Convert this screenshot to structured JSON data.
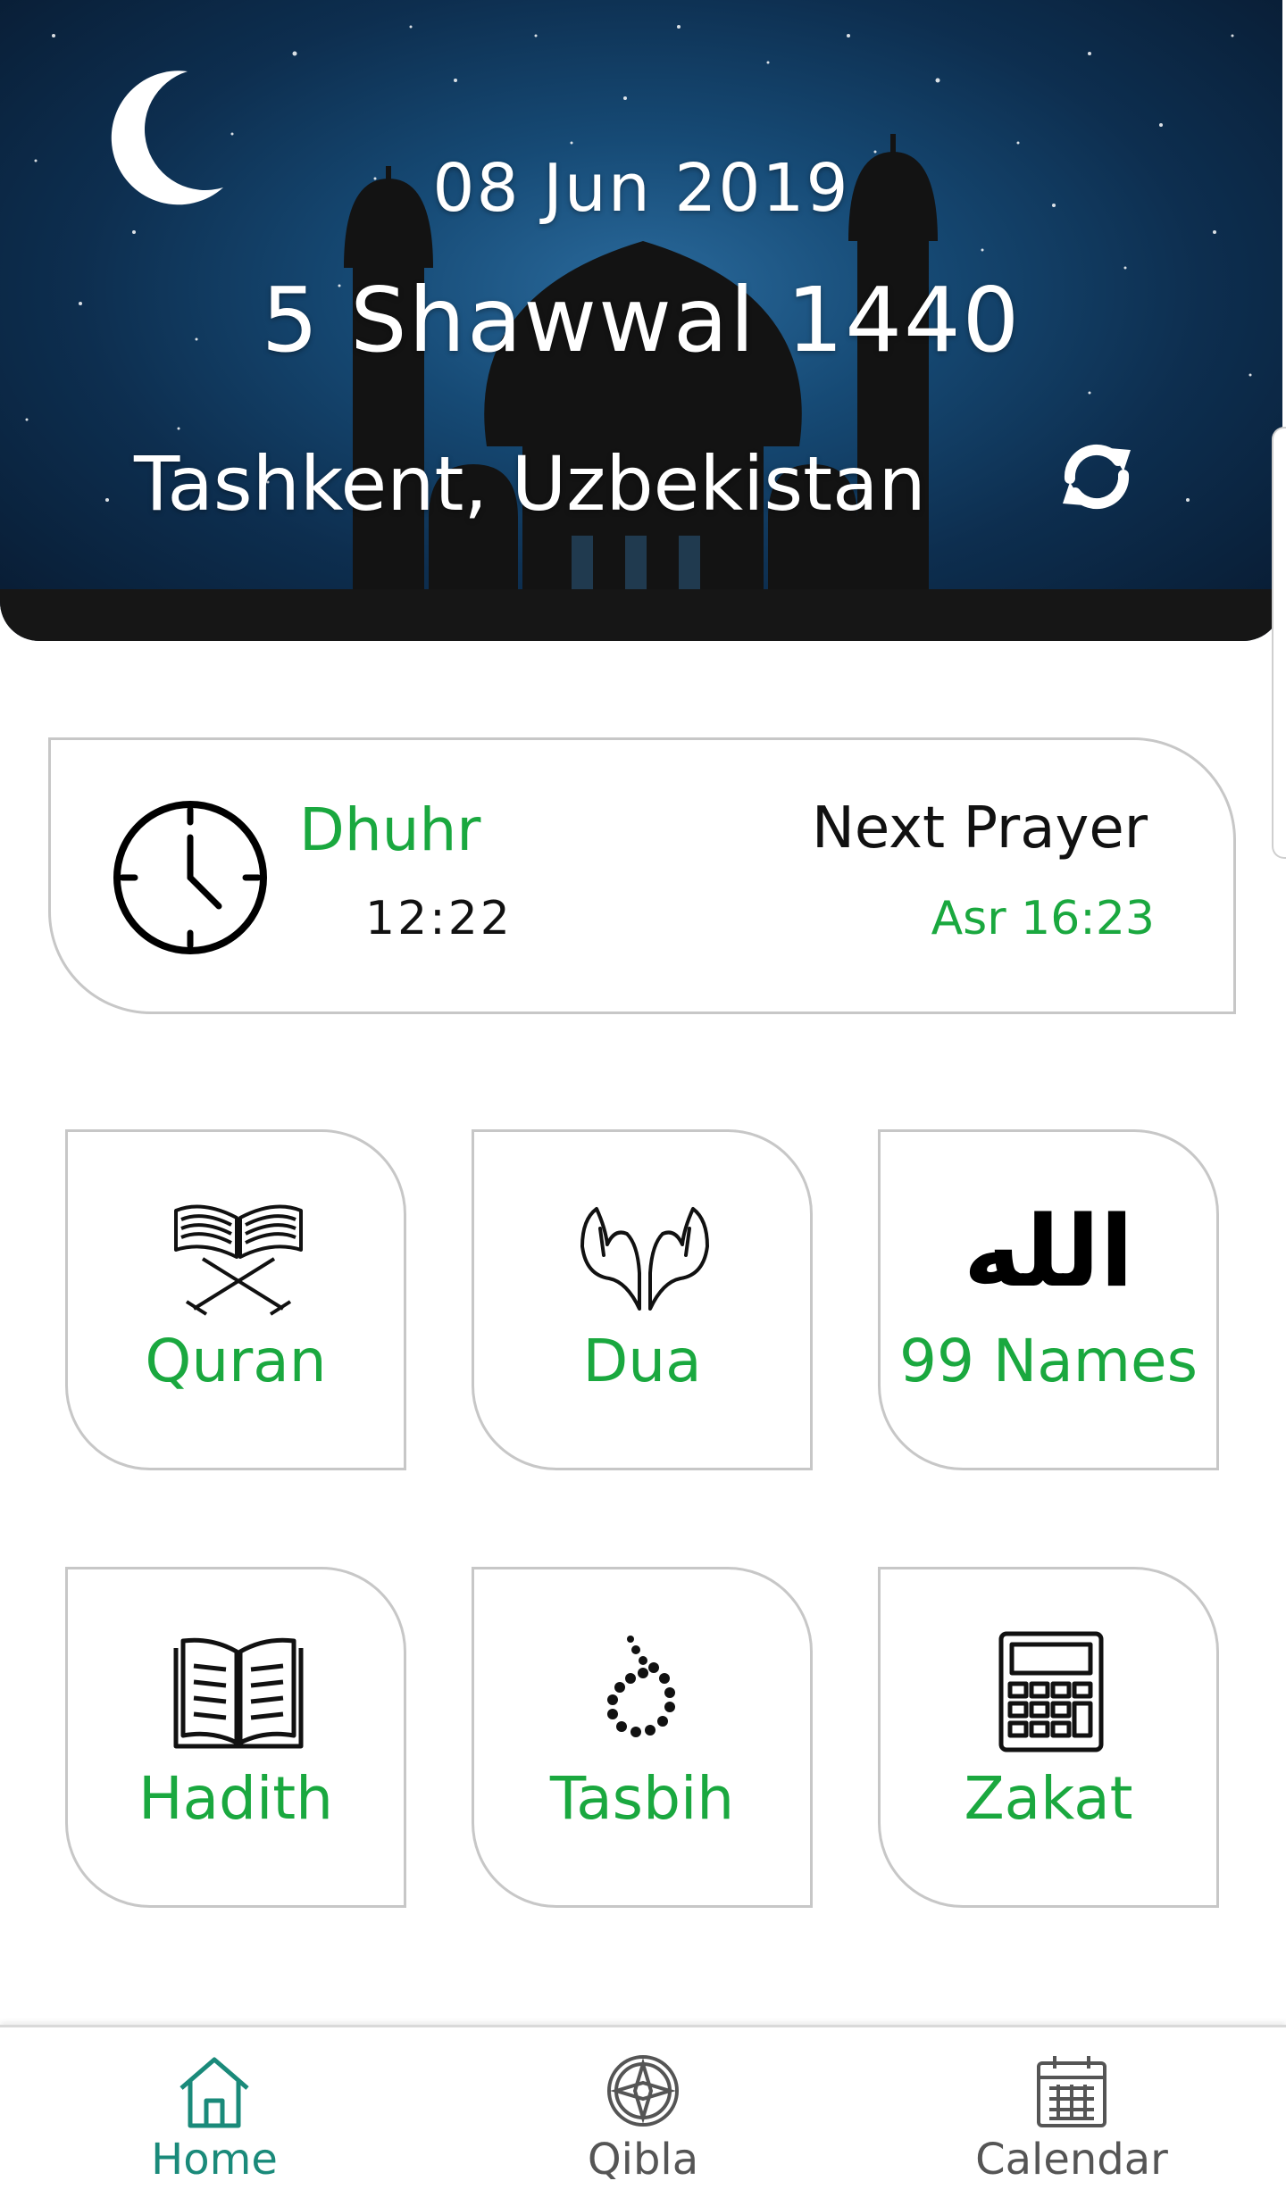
{
  "header": {
    "gregorian_date": "08 Jun 2019",
    "hijri_date": "5 Shawwal 1440",
    "location": "Tashkent, Uzbekistan",
    "refresh_icon": "refresh-icon",
    "moon_icon": "crescent-moon-icon"
  },
  "prayer": {
    "current_name": "Dhuhr",
    "current_time": "12:22",
    "next_label": "Next Prayer",
    "next_value": "Asr 16:23"
  },
  "tiles": [
    {
      "label": "Quran",
      "icon": "quran-icon"
    },
    {
      "label": "Dua",
      "icon": "praying-hands-icon"
    },
    {
      "label": "99 Names",
      "icon": "allah-calligraphy-icon",
      "glyph": "الله"
    },
    {
      "label": "Hadith",
      "icon": "open-book-icon"
    },
    {
      "label": "Tasbih",
      "icon": "prayer-beads-icon"
    },
    {
      "label": "Zakat",
      "icon": "calculator-icon"
    }
  ],
  "nav": [
    {
      "label": "Home",
      "icon": "home-icon",
      "active": true
    },
    {
      "label": "Qibla",
      "icon": "compass-icon",
      "active": false
    },
    {
      "label": "Calendar",
      "icon": "calendar-icon",
      "active": false
    }
  ],
  "colors": {
    "accent_green": "#1aa83f",
    "nav_active": "#1a8a7a",
    "nav_inactive": "#555555",
    "header_blue": "#164a75"
  }
}
